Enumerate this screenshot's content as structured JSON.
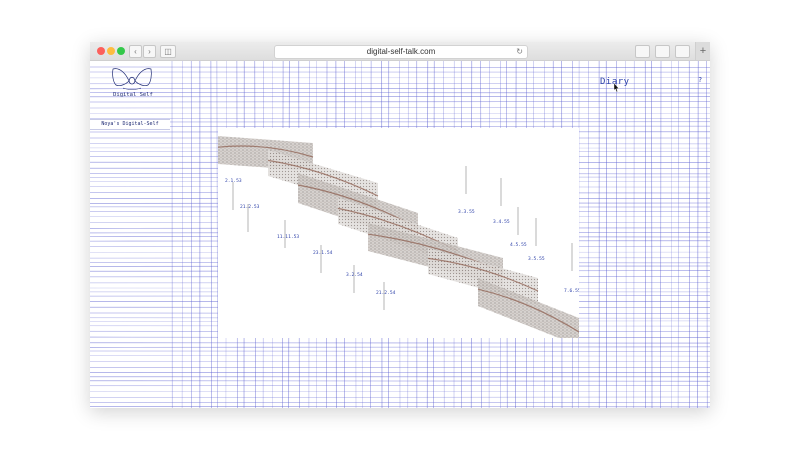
{
  "browser": {
    "url": "digital-self-talk.com",
    "back_icon": "chevron-left-icon",
    "forward_icon": "chevron-right-icon",
    "reload_icon": "reload-icon",
    "new_tab_label": "+"
  },
  "site": {
    "logo_text": "Digital Self",
    "diary_link": "Diary",
    "help_label": "?",
    "profile_tab": "Noya's Digital-Self"
  },
  "colors": {
    "grid_line": "#5b5fd1",
    "text_accent": "#2b3fa8"
  },
  "viz": {
    "date_labels": [
      "2.1.53",
      "21.2.53",
      "11.11.53",
      "23.1.54",
      "3.2.54",
      "21.2.54",
      "3.3.55",
      "3.4.55",
      "4.5.55",
      "3.5.55",
      "7.6.55"
    ]
  }
}
